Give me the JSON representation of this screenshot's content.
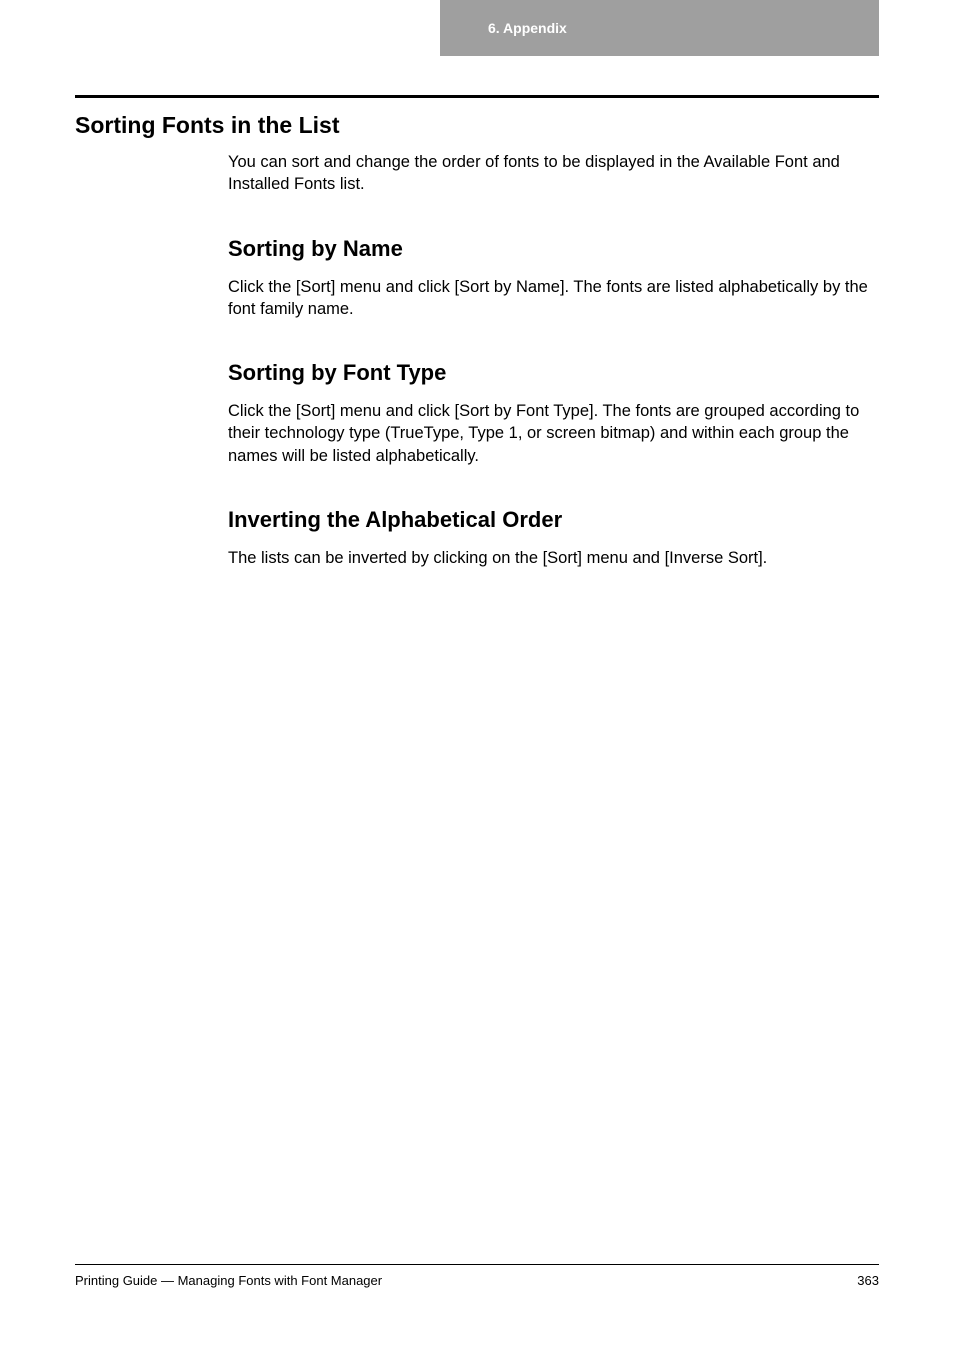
{
  "header": {
    "chapter": "6. Appendix"
  },
  "main": {
    "title": "Sorting Fonts in the List",
    "intro": "You can sort and change the order of fonts to be displayed in the Available Font and Installed Fonts list.",
    "sections": [
      {
        "heading": "Sorting by Name",
        "body": "Click the [Sort] menu and click [Sort by Name]. The fonts are listed alphabetically by the font family name."
      },
      {
        "heading": "Sorting by Font Type",
        "body": "Click the [Sort] menu and click [Sort by Font Type]. The fonts are grouped according to their technology type (TrueType, Type 1, or screen bitmap) and within each group the names will be listed alphabetically."
      },
      {
        "heading": "Inverting the Alphabetical Order",
        "body": "The lists can be inverted by clicking on the [Sort] menu and [Inverse Sort]."
      }
    ]
  },
  "footer": {
    "doc_title": "Printing Guide — Managing Fonts with Font Manager",
    "page_number": "363"
  }
}
